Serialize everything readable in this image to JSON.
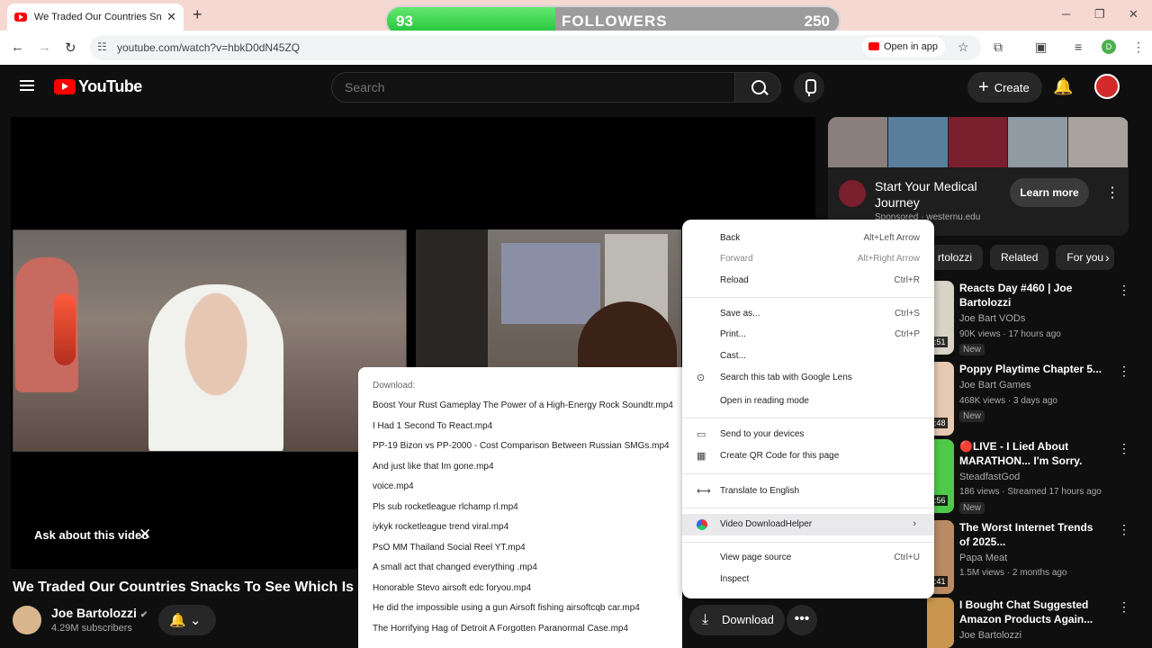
{
  "browser": {
    "tab_title": "We Traded Our Countries Snack",
    "url": "youtube.com/watch?v=hbkD0dN45ZQ",
    "open_in_app": "Open in app",
    "profile_letter": "D"
  },
  "followers_bar": {
    "current": "93",
    "label": "FOLLOWERS",
    "goal": "250",
    "progress_fraction": 0.372
  },
  "youtube": {
    "logo": "YouTube",
    "search_placeholder": "Search",
    "create_label": "Create"
  },
  "player": {
    "ask_label": "Ask about this video"
  },
  "video": {
    "title": "We Traded Our Countries Snacks To See Which Is Be",
    "channel": "Joe Bartolozzi",
    "subscribers": "4.29M subscribers",
    "download_label": "Download"
  },
  "ad": {
    "title": "Start Your Medical Journey",
    "sponsor": "Sponsored · westernu.edu",
    "learn_more": "Learn more",
    "image_colors": [
      "#8a7f7a",
      "#5a7f9c",
      "#7a1f2d",
      "#8f9aa3",
      "#a7a29b"
    ]
  },
  "chips": [
    "rtolozzi",
    "Related",
    "For you"
  ],
  "recommendations": [
    {
      "title": "Reacts Day #460 | Joe Bartolozzi",
      "channel": "Joe Bart VODs",
      "meta": "90K views · 17 hours ago",
      "badge": "New",
      "duration": ":51",
      "color": "#d9d2c6"
    },
    {
      "title": "Poppy Playtime Chapter 5...",
      "channel": "Joe Bart Games",
      "meta": "468K views · 3 days ago",
      "badge": "New",
      "duration": ":48",
      "color": "#e6c9b3"
    },
    {
      "title": "🔴LIVE - I Lied About MARATHON... I'm Sorry.",
      "channel": "SteadfastGod",
      "meta": "186 views · Streamed 17 hours ago",
      "badge": "New",
      "duration": ":56",
      "color": "#4ec94a"
    },
    {
      "title": "The Worst Internet Trends of 2025...",
      "channel": "Papa Meat",
      "meta": "1.5M views · 2 months ago",
      "badge": "",
      "duration": ":41",
      "color": "#b98a63"
    },
    {
      "title": "I Bought Chat Suggested Amazon Products Again...",
      "channel": "Joe Bartolozzi",
      "meta": "",
      "badge": "",
      "duration": "",
      "color": "#c8964f"
    }
  ],
  "download_menu": {
    "header": "Download:",
    "items": [
      "Boost Your Rust Gameplay The Power of a High-Energy Rock Soundtr.mp4",
      "I Had 1 Second To React.mp4",
      "PP-19 Bizon vs PP-2000 - Cost Comparison Between Russian SMGs.mp4",
      "And just like that Im gone.mp4",
      "voice.mp4",
      "Pls sub rocketleague rlchamp rl.mp4",
      "iykyk rocketleague trend viral.mp4",
      "PsO MM Thailand Social Reel YT.mp4",
      "A small act that changed everything .mp4",
      "Honorable Stevo airsoft edc foryou.mp4",
      "He did the impossible using a gun Airsoft fishing airsoftcqb car.mp4",
      "The Horrifying Hag of Detroit A Forgotten Paranormal Case.mp4"
    ]
  },
  "context_menu": {
    "back": "Back",
    "back_sc": "Alt+Left Arrow",
    "forward": "Forward",
    "forward_sc": "Alt+Right Arrow",
    "reload": "Reload",
    "reload_sc": "Ctrl+R",
    "save_as": "Save as...",
    "save_as_sc": "Ctrl+S",
    "print": "Print...",
    "print_sc": "Ctrl+P",
    "cast": "Cast...",
    "lens": "Search this tab with Google Lens",
    "reading_mode": "Open in reading mode",
    "send_devices": "Send to your devices",
    "qr": "Create QR Code for this page",
    "translate": "Translate to English",
    "vdh": "Video DownloadHelper",
    "view_source": "View page source",
    "view_source_sc": "Ctrl+U",
    "inspect": "Inspect"
  }
}
